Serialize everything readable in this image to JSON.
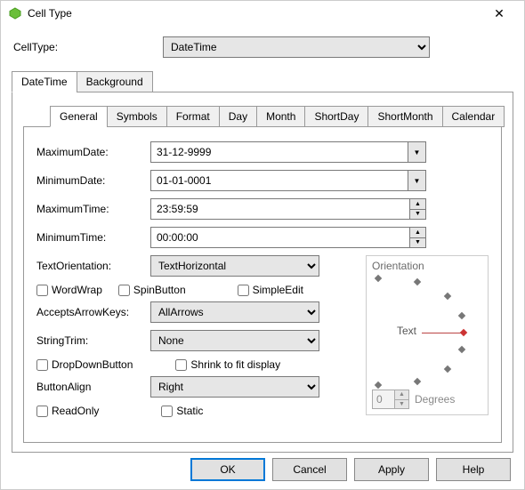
{
  "window": {
    "title": "Cell Type",
    "close_icon": "✕"
  },
  "cellType": {
    "label": "CellType:",
    "value": "DateTime"
  },
  "outerTabs": [
    {
      "label": "DateTime"
    },
    {
      "label": "Background"
    }
  ],
  "innerTabs": [
    {
      "label": "General"
    },
    {
      "label": "Symbols"
    },
    {
      "label": "Format"
    },
    {
      "label": "Day"
    },
    {
      "label": "Month"
    },
    {
      "label": "ShortDay"
    },
    {
      "label": "ShortMonth"
    },
    {
      "label": "Calendar"
    }
  ],
  "form": {
    "maxDate": {
      "label": "MaximumDate:",
      "value": "31-12-9999"
    },
    "minDate": {
      "label": "MinimumDate:",
      "value": "01-01-0001"
    },
    "maxTime": {
      "label": "MaximumTime:",
      "value": "23:59:59"
    },
    "minTime": {
      "label": "MinimumTime:",
      "value": "00:00:00"
    },
    "textOrientation": {
      "label": "TextOrientation:",
      "value": "TextHorizontal"
    },
    "wordWrap": {
      "label": "WordWrap",
      "checked": false
    },
    "spinButton": {
      "label": "SpinButton",
      "checked": false
    },
    "simpleEdit": {
      "label": "SimpleEdit",
      "checked": false
    },
    "acceptsArrowKeys": {
      "label": "AcceptsArrowKeys:",
      "value": "AllArrows"
    },
    "stringTrim": {
      "label": "StringTrim:",
      "value": "None"
    },
    "dropDownButton": {
      "label": "DropDownButton",
      "checked": false
    },
    "shrinkToFit": {
      "label": "Shrink to fit display",
      "checked": false
    },
    "buttonAlign": {
      "label": "ButtonAlign",
      "value": "Right"
    },
    "readOnly": {
      "label": "ReadOnly",
      "checked": false
    },
    "static": {
      "label": "Static",
      "checked": false
    }
  },
  "orientation": {
    "title": "Orientation",
    "textLabel": "Text",
    "degrees": {
      "value": "0",
      "label": "Degrees"
    }
  },
  "buttons": {
    "ok": "OK",
    "cancel": "Cancel",
    "apply": "Apply",
    "help": "Help"
  },
  "glyphs": {
    "down": "▼",
    "up": "▲"
  }
}
